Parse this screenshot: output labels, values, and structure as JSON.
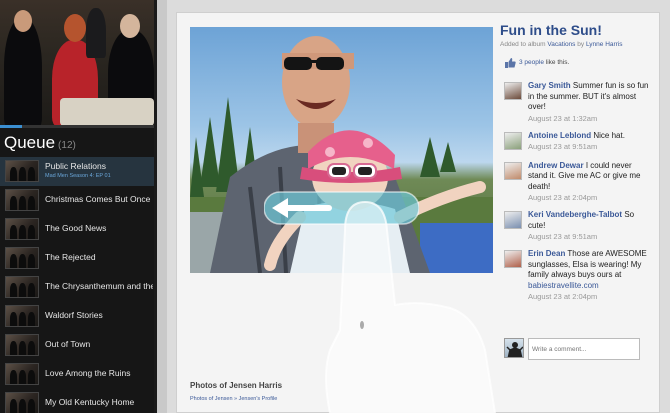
{
  "queue": {
    "title": "Queue",
    "count": "(12)",
    "progress_fraction": 0.14,
    "items": [
      {
        "label": "Public Relations",
        "sub": "Mad Men Season 4: EP 01"
      },
      {
        "label": "Christmas Comes But Once a Y"
      },
      {
        "label": "The Good News"
      },
      {
        "label": "The Rejected"
      },
      {
        "label": "The Chrysanthemum and the S"
      },
      {
        "label": "Waldorf Stories"
      },
      {
        "label": "Out of Town"
      },
      {
        "label": "Love Among the Ruins"
      },
      {
        "label": "My Old Kentucky Home"
      }
    ]
  },
  "album": {
    "title": "Fun in the Sun!",
    "added_prefix": "Added to album",
    "album_link": "Vacations",
    "by": "by",
    "owner": "Lynne Harris",
    "likes_link": "3 people",
    "likes_suffix": "like this."
  },
  "comments": [
    {
      "name": "Gary Smith",
      "text": "Summer fun is so fun in the summer.  BUT it's almost over!",
      "time": "August 23 at 1:32am",
      "avatar": "#6b4a3a"
    },
    {
      "name": "Antoine Leblond",
      "text": "Nice hat.",
      "time": "August 23 at 9:51am",
      "avatar": "#8aa07a"
    },
    {
      "name": "Andrew Dewar",
      "text": "I could never stand it.  Give me AC or give me death!",
      "time": "August 23 at 2:04pm",
      "avatar": "#c08a6a"
    },
    {
      "name": "Keri Vandeberghe-Talbot",
      "text": "So cute!",
      "time": "August 23 at 9:51am",
      "avatar": "#7a8fb0"
    },
    {
      "name": "Erin Dean",
      "text": "Those are AWESOME sunglasses, Elsa is wearing! My family always buys ours at",
      "link": "babiestravellite.com",
      "time": "August 23 at 2:04pm",
      "avatar": "#b0604a"
    }
  ],
  "composer": {
    "placeholder": "Write a comment..."
  },
  "footer": {
    "title": "Photos of Jensen Harris",
    "crumbs": "Photos of Jensen  »  Jensen's Profile"
  },
  "colors": {
    "accent": "#3b8fd1",
    "link": "#3b5998",
    "title": "#2e4d8a"
  }
}
